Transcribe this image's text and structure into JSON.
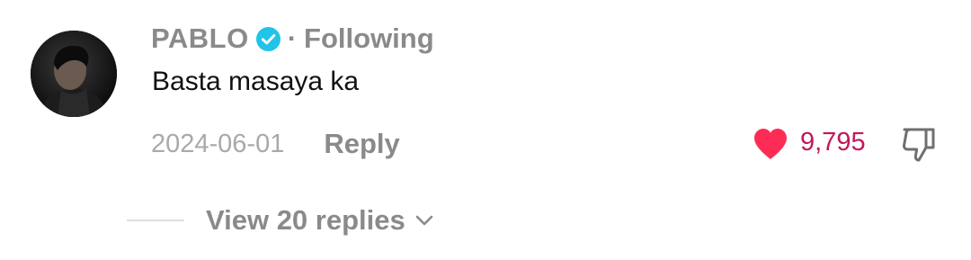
{
  "comment": {
    "username": "PABLO",
    "verified_icon": "verified-badge-icon",
    "separator": "·",
    "follow_status": "Following",
    "text": "Basta masaya ka",
    "date": "2024-06-01",
    "reply_label": "Reply",
    "like_icon": "heart-icon",
    "like_count": "9,795",
    "dislike_icon": "thumbs-down-icon",
    "replies_label": "View 20 replies",
    "replies_icon": "chevron-down-icon"
  },
  "colors": {
    "verified": "#20c4e8",
    "like": "#fe2c55",
    "like_count": "#c2185b",
    "muted_text": "#8a8a8a",
    "date_text": "#a9a9a9"
  }
}
